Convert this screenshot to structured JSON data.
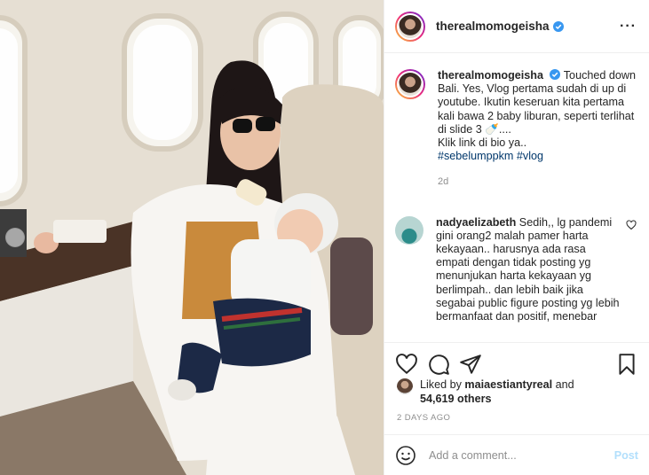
{
  "post": {
    "username": "therealmomogeisha",
    "more_icon": "more-horizontal-icon",
    "caption": {
      "username": "therealmomogeisha",
      "text": "Touched down Bali. Yes, Vlog pertama sudah di up di youtube. Ikutin keseruan kita pertama kali bawa 2 baby liburan, seperti terlihat di slide 3 🍼....",
      "line2": "Klik link di bio ya..",
      "hashtags": "#sebelumppkm #vlog",
      "time": "2d"
    },
    "comments": [
      {
        "username": "nadyaelizabeth",
        "text": "Sedih,, lg pandemi gini orang2 malah pamer harta kekayaan.. harusnya ada rasa empati dengan tidak posting yg menunjukan harta kekayaan yg berlimpah.. dan lebih baik jika segabai public figure posting yg lebih bermanfaat dan positif, menebar"
      }
    ],
    "likes": {
      "prefix": "Liked by",
      "user": "maiaestiantyreal",
      "middle": "and",
      "count": "54,619 others"
    },
    "posted_ago": "2 DAYS AGO",
    "add_comment": {
      "placeholder": "Add a comment...",
      "post_label": "Post"
    }
  },
  "colors": {
    "accent_link": "#00376b",
    "post_disabled": "#b2dffc",
    "verified": "#3897f0",
    "muted": "#8e8e8e"
  }
}
